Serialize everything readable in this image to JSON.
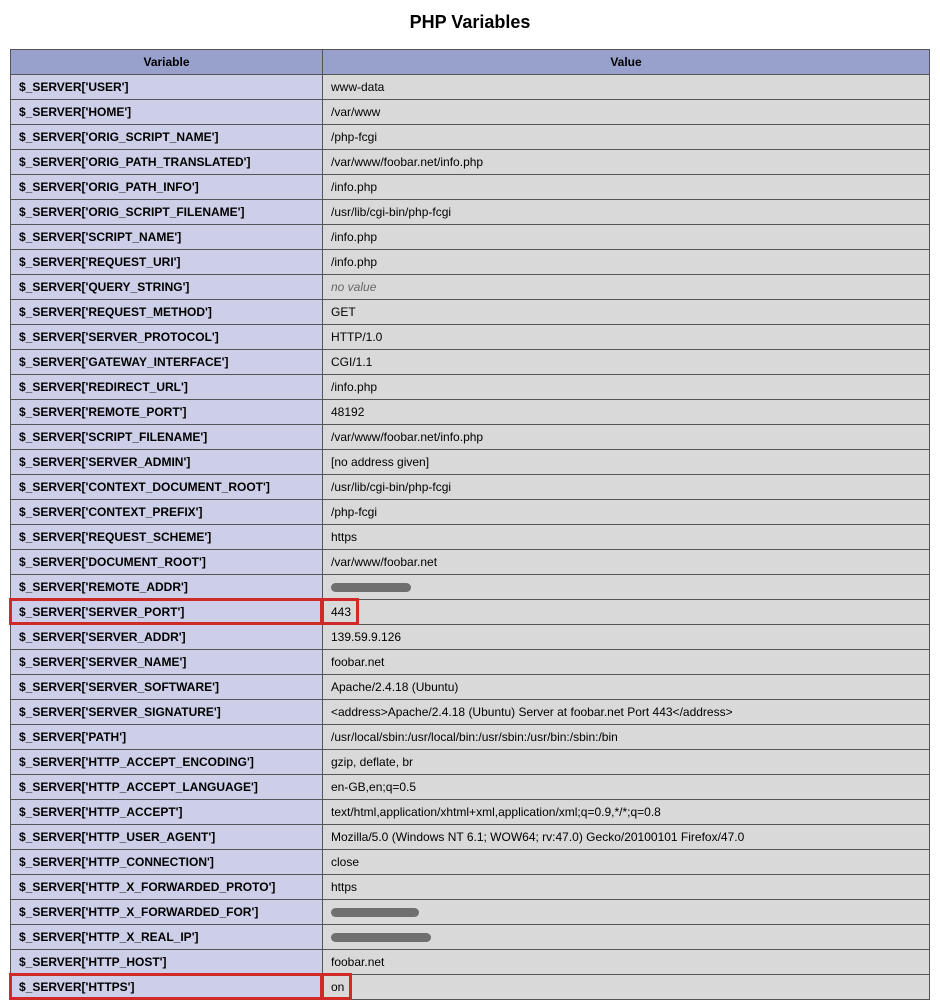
{
  "title": "PHP Variables",
  "columns": {
    "variable": "Variable",
    "value": "Value"
  },
  "rows": [
    {
      "key": "$_SERVER['USER']",
      "value": "www-data"
    },
    {
      "key": "$_SERVER['HOME']",
      "value": "/var/www"
    },
    {
      "key": "$_SERVER['ORIG_SCRIPT_NAME']",
      "value": "/php-fcgi"
    },
    {
      "key": "$_SERVER['ORIG_PATH_TRANSLATED']",
      "value": "/var/www/foobar.net/info.php"
    },
    {
      "key": "$_SERVER['ORIG_PATH_INFO']",
      "value": "/info.php"
    },
    {
      "key": "$_SERVER['ORIG_SCRIPT_FILENAME']",
      "value": "/usr/lib/cgi-bin/php-fcgi"
    },
    {
      "key": "$_SERVER['SCRIPT_NAME']",
      "value": "/info.php"
    },
    {
      "key": "$_SERVER['REQUEST_URI']",
      "value": "/info.php"
    },
    {
      "key": "$_SERVER['QUERY_STRING']",
      "value": "no value",
      "noValue": true
    },
    {
      "key": "$_SERVER['REQUEST_METHOD']",
      "value": "GET"
    },
    {
      "key": "$_SERVER['SERVER_PROTOCOL']",
      "value": "HTTP/1.0"
    },
    {
      "key": "$_SERVER['GATEWAY_INTERFACE']",
      "value": "CGI/1.1"
    },
    {
      "key": "$_SERVER['REDIRECT_URL']",
      "value": "/info.php"
    },
    {
      "key": "$_SERVER['REMOTE_PORT']",
      "value": "48192"
    },
    {
      "key": "$_SERVER['SCRIPT_FILENAME']",
      "value": "/var/www/foobar.net/info.php"
    },
    {
      "key": "$_SERVER['SERVER_ADMIN']",
      "value": "[no address given]"
    },
    {
      "key": "$_SERVER['CONTEXT_DOCUMENT_ROOT']",
      "value": "/usr/lib/cgi-bin/php-fcgi"
    },
    {
      "key": "$_SERVER['CONTEXT_PREFIX']",
      "value": "/php-fcgi"
    },
    {
      "key": "$_SERVER['REQUEST_SCHEME']",
      "value": "https"
    },
    {
      "key": "$_SERVER['DOCUMENT_ROOT']",
      "value": "/var/www/foobar.net"
    },
    {
      "key": "$_SERVER['REMOTE_ADDR']",
      "value": "",
      "redacted": true,
      "redactW": 80
    },
    {
      "key": "$_SERVER['SERVER_PORT']",
      "value": "443",
      "highlight": true
    },
    {
      "key": "$_SERVER['SERVER_ADDR']",
      "value": "139.59.9.126"
    },
    {
      "key": "$_SERVER['SERVER_NAME']",
      "value": "foobar.net"
    },
    {
      "key": "$_SERVER['SERVER_SOFTWARE']",
      "value": "Apache/2.4.18 (Ubuntu)"
    },
    {
      "key": "$_SERVER['SERVER_SIGNATURE']",
      "value": "<address>Apache/2.4.18 (Ubuntu) Server at foobar.net Port 443</address>"
    },
    {
      "key": "$_SERVER['PATH']",
      "value": "/usr/local/sbin:/usr/local/bin:/usr/sbin:/usr/bin:/sbin:/bin"
    },
    {
      "key": "$_SERVER['HTTP_ACCEPT_ENCODING']",
      "value": "gzip, deflate, br"
    },
    {
      "key": "$_SERVER['HTTP_ACCEPT_LANGUAGE']",
      "value": "en-GB,en;q=0.5"
    },
    {
      "key": "$_SERVER['HTTP_ACCEPT']",
      "value": "text/html,application/xhtml+xml,application/xml;q=0.9,*/*;q=0.8"
    },
    {
      "key": "$_SERVER['HTTP_USER_AGENT']",
      "value": "Mozilla/5.0 (Windows NT 6.1; WOW64; rv:47.0) Gecko/20100101 Firefox/47.0"
    },
    {
      "key": "$_SERVER['HTTP_CONNECTION']",
      "value": "close"
    },
    {
      "key": "$_SERVER['HTTP_X_FORWARDED_PROTO']",
      "value": "https"
    },
    {
      "key": "$_SERVER['HTTP_X_FORWARDED_FOR']",
      "value": "",
      "redacted": true,
      "redactW": 88
    },
    {
      "key": "$_SERVER['HTTP_X_REAL_IP']",
      "value": "",
      "redacted": true,
      "redactW": 100
    },
    {
      "key": "$_SERVER['HTTP_HOST']",
      "value": "foobar.net"
    },
    {
      "key": "$_SERVER['HTTPS']",
      "value": "on",
      "highlight": true
    }
  ]
}
